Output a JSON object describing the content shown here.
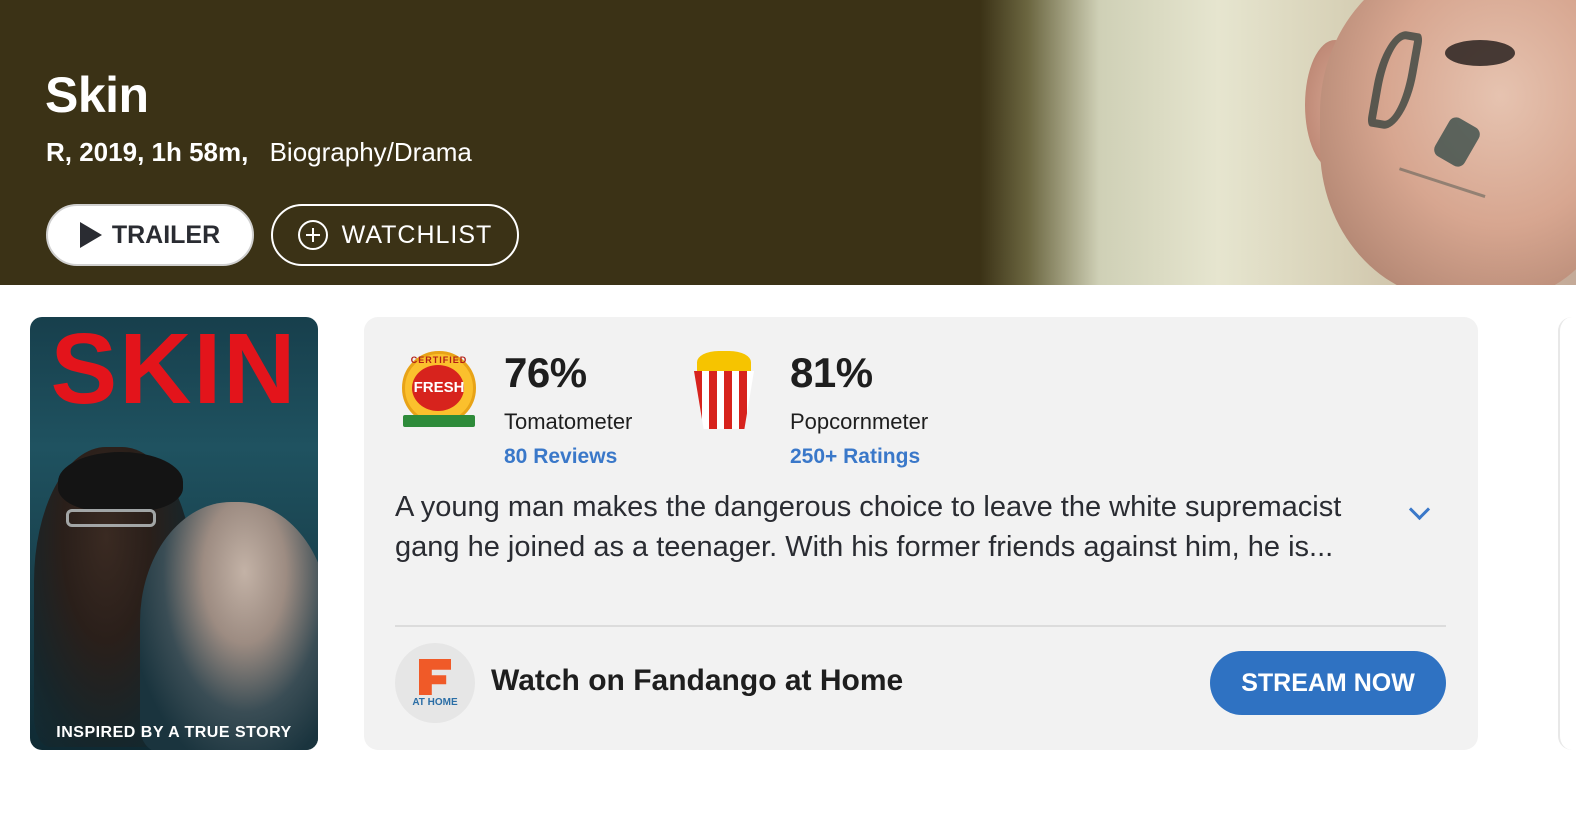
{
  "hero": {
    "title": "Skin",
    "meta": "R, 2019, 1h 58m,",
    "genre": "Biography/Drama",
    "trailer_label": "TRAILER",
    "watchlist_label": "WATCHLIST"
  },
  "poster": {
    "title": "SKIN",
    "tagline": "INSPIRED BY A TRUE STORY"
  },
  "scores": {
    "tomatometer": {
      "badge_certified": "CERTIFIED",
      "badge_fresh": "FRESH",
      "value": "76%",
      "label": "Tomatometer",
      "link": "80 Reviews"
    },
    "popcornmeter": {
      "value": "81%",
      "label": "Popcornmeter",
      "link": "250+ Ratings"
    }
  },
  "synopsis": "A young man makes the dangerous choice to leave the white supremacist gang he joined as a teenager. With his former friends against him, he is...",
  "streaming": {
    "logo_subtext": "AT HOME",
    "label": "Watch on Fandango at Home",
    "button_label": "STREAM NOW"
  },
  "colors": {
    "hero_bg": "#3b3216",
    "accent_blue": "#3a78c9",
    "stream_button": "#2f72c2",
    "card_bg": "#f2f2f2"
  }
}
